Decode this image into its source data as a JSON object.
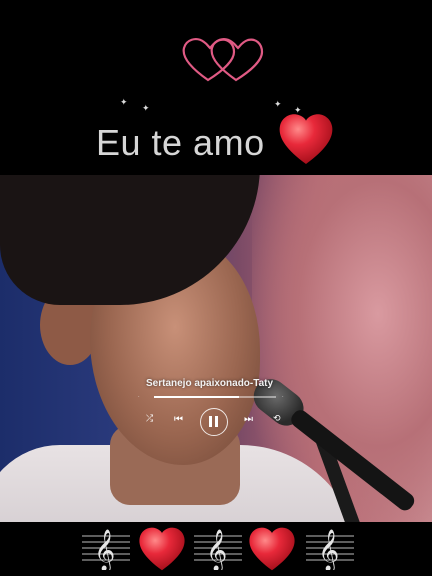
{
  "header": {
    "title": "Eu te amo",
    "heart_color": "#e8293a",
    "outline_heart_color": "#e05a84"
  },
  "player": {
    "song_title": "Sertanejo apaixonado-Taty",
    "progress": 0.7,
    "icons": [
      "shuffle-icon",
      "previous-icon",
      "pause-icon",
      "next-icon",
      "repeat-icon"
    ]
  },
  "footer": {
    "icons": [
      "treble-clef-icon",
      "heart-icon",
      "treble-clef-icon",
      "heart-icon",
      "treble-clef-icon"
    ]
  }
}
